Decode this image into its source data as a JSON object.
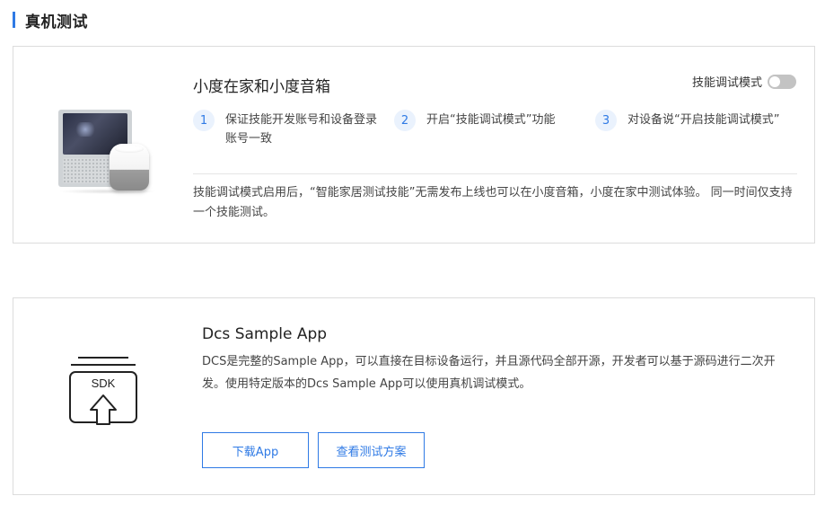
{
  "section": {
    "title": "真机测试"
  },
  "device_card": {
    "title": "小度在家和小度音箱",
    "toggle": {
      "label": "技能调试模式",
      "enabled": false
    },
    "steps": [
      {
        "number": "1",
        "text": "保证技能开发账号和设备登录账号一致"
      },
      {
        "number": "2",
        "text": "开启“技能调试模式”功能"
      },
      {
        "number": "3",
        "text": "对设备说“开启技能调试模式”"
      }
    ],
    "note": "技能调试模式启用后，“智能家居测试技能”无需发布上线也可以在小度音箱，小度在家中测试体验。 同一时间仅支持一个技能测试。"
  },
  "sdk_card": {
    "icon_label": "SDK",
    "title": "Dcs Sample App",
    "description": "DCS是完整的Sample App，可以直接在目标设备运行，并且源代码全部开源，开发者可以基于源码进行二次开发。使用特定版本的Dcs Sample App可以使用真机调试模式。",
    "buttons": {
      "download": "下载App",
      "view_plan": "查看测试方案"
    }
  },
  "colors": {
    "accent": "#2f7ae5",
    "border": "#dcdcdc",
    "toggle_off": "#c3c3c3",
    "step_circle_bg": "#eaf2fd"
  }
}
